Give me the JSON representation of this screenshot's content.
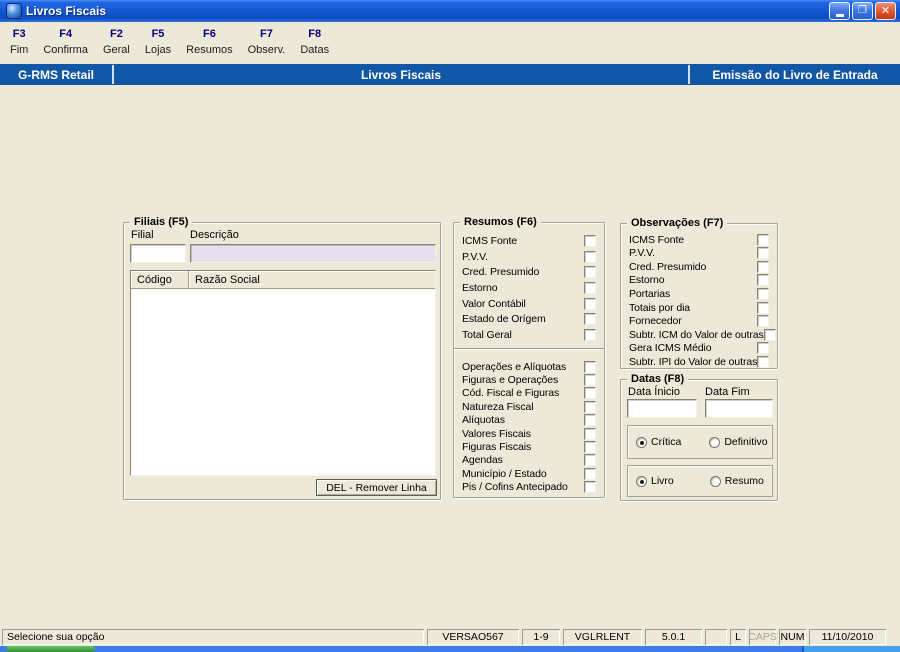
{
  "window": {
    "title": "Livros Fiscais",
    "controls": {
      "restore": "❐",
      "close": "✕"
    }
  },
  "toolbar": {
    "items": [
      {
        "key": "F3",
        "label": "Fim"
      },
      {
        "key": "F4",
        "label": "Confirma"
      },
      {
        "key": "F2",
        "label": "Geral"
      },
      {
        "key": "F5",
        "label": "Lojas"
      },
      {
        "key": "F6",
        "label": "Resumos"
      },
      {
        "key": "F7",
        "label": "Observ."
      },
      {
        "key": "F8",
        "label": "Datas"
      }
    ]
  },
  "header": {
    "left": "G-RMS Retail",
    "center": "Livros Fiscais",
    "right": "Emissão do Livro de Entrada"
  },
  "filiais": {
    "title": "Filiais (F5)",
    "filial_label": "Filial",
    "descricao_label": "Descrição",
    "filial_value": "",
    "descricao_value": "",
    "table": {
      "columns": [
        "Código",
        "Razão Social"
      ],
      "rows": []
    },
    "remove_button": "DEL - Remover Linha"
  },
  "resumos": {
    "title": "Resumos (F6)",
    "group1": [
      "ICMS Fonte",
      "P.V.V.",
      "Cred. Presumido",
      "Estorno",
      "Valor Contábil",
      "Estado de Orígem",
      "Total Geral"
    ],
    "group2": [
      "Operações e Alíquotas",
      "Figuras e Operações",
      "Cód. Fiscal e Figuras",
      "Natureza Fiscal",
      "Alíquotas",
      "Valores Fiscais",
      "Figuras Fiscais",
      "Agendas",
      "Município / Estado",
      "Pis / Cofins Antecipado"
    ]
  },
  "observacoes": {
    "title": "Observações (F7)",
    "items": [
      "ICMS Fonte",
      "P.V.V.",
      "Cred. Presumido",
      "Estorno",
      "Portarias",
      "Totais por dia",
      "Fornecedor",
      "Subtr. ICM do Valor de outras",
      "Gera ICMS Médio",
      "Subtr. IPI do Valor de outras"
    ]
  },
  "datas": {
    "title": "Datas (F8)",
    "inicio_label": "Data Ínicio",
    "fim_label": "Data Fim",
    "inicio_value": "",
    "fim_value": "",
    "radio_group1": [
      {
        "label": "Crítica",
        "selected": true
      },
      {
        "label": "Definitivo",
        "selected": false
      }
    ],
    "radio_group2": [
      {
        "label": "Livro",
        "selected": true
      },
      {
        "label": "Resumo",
        "selected": false
      }
    ]
  },
  "statusbar": {
    "message": "Selecione sua opção",
    "version": "VERSAO567",
    "counter": "1-9",
    "program": "VGLRLENT",
    "release": "5.0.1",
    "l_indicator": "L",
    "caps": "CAPS",
    "num": "NUM",
    "date": "11/10/2010"
  },
  "colors": {
    "header_blue": "#1157A6",
    "background": "#ECE9D8",
    "disabled_field": "#E4E1ED",
    "taskbar_blue": "#3E7DE8",
    "start_green": "#2E8F2E"
  }
}
